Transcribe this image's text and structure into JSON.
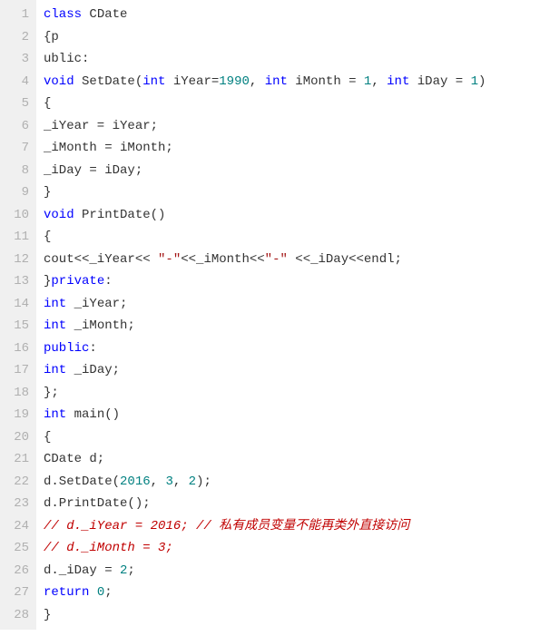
{
  "lines": [
    {
      "n": "1",
      "tokens": [
        {
          "t": "kw",
          "v": "class"
        },
        {
          "t": "plain",
          "v": " CDate"
        }
      ]
    },
    {
      "n": "2",
      "tokens": [
        {
          "t": "plain",
          "v": "{p"
        }
      ]
    },
    {
      "n": "3",
      "tokens": [
        {
          "t": "plain",
          "v": "ublic:"
        }
      ]
    },
    {
      "n": "4",
      "tokens": [
        {
          "t": "kw",
          "v": "void"
        },
        {
          "t": "plain",
          "v": " SetDate("
        },
        {
          "t": "kw",
          "v": "int"
        },
        {
          "t": "plain",
          "v": " iYear="
        },
        {
          "t": "num",
          "v": "1990"
        },
        {
          "t": "plain",
          "v": ", "
        },
        {
          "t": "kw",
          "v": "int"
        },
        {
          "t": "plain",
          "v": " iMonth = "
        },
        {
          "t": "num",
          "v": "1"
        },
        {
          "t": "plain",
          "v": ", "
        },
        {
          "t": "kw",
          "v": "int"
        },
        {
          "t": "plain",
          "v": " iDay = "
        },
        {
          "t": "num",
          "v": "1"
        },
        {
          "t": "plain",
          "v": ")"
        }
      ]
    },
    {
      "n": "5",
      "tokens": [
        {
          "t": "plain",
          "v": "{"
        }
      ]
    },
    {
      "n": "6",
      "tokens": [
        {
          "t": "plain",
          "v": "_iYear = iYear;"
        }
      ]
    },
    {
      "n": "7",
      "tokens": [
        {
          "t": "plain",
          "v": "_iMonth = iMonth;"
        }
      ]
    },
    {
      "n": "8",
      "tokens": [
        {
          "t": "plain",
          "v": "_iDay = iDay;"
        }
      ]
    },
    {
      "n": "9",
      "tokens": [
        {
          "t": "plain",
          "v": "}"
        }
      ]
    },
    {
      "n": "10",
      "tokens": [
        {
          "t": "kw",
          "v": "void"
        },
        {
          "t": "plain",
          "v": " PrintDate()"
        }
      ]
    },
    {
      "n": "11",
      "tokens": [
        {
          "t": "plain",
          "v": "{"
        }
      ]
    },
    {
      "n": "12",
      "tokens": [
        {
          "t": "plain",
          "v": "cout<<_iYear<< "
        },
        {
          "t": "str",
          "v": "\"-\""
        },
        {
          "t": "plain",
          "v": "<<_iMonth<<"
        },
        {
          "t": "str",
          "v": "\"-\""
        },
        {
          "t": "plain",
          "v": " <<_iDay<<endl;"
        }
      ]
    },
    {
      "n": "13",
      "tokens": [
        {
          "t": "plain",
          "v": "}"
        },
        {
          "t": "kw",
          "v": "private"
        },
        {
          "t": "plain",
          "v": ":"
        }
      ]
    },
    {
      "n": "14",
      "tokens": [
        {
          "t": "kw",
          "v": "int"
        },
        {
          "t": "plain",
          "v": " _iYear;"
        }
      ]
    },
    {
      "n": "15",
      "tokens": [
        {
          "t": "kw",
          "v": "int"
        },
        {
          "t": "plain",
          "v": " _iMonth;"
        }
      ]
    },
    {
      "n": "16",
      "tokens": [
        {
          "t": "kw",
          "v": "public"
        },
        {
          "t": "plain",
          "v": ":"
        }
      ]
    },
    {
      "n": "17",
      "tokens": [
        {
          "t": "kw",
          "v": "int"
        },
        {
          "t": "plain",
          "v": " _iDay;"
        }
      ]
    },
    {
      "n": "18",
      "tokens": [
        {
          "t": "plain",
          "v": "};"
        }
      ]
    },
    {
      "n": "19",
      "tokens": [
        {
          "t": "kw",
          "v": "int"
        },
        {
          "t": "plain",
          "v": " main()"
        }
      ]
    },
    {
      "n": "20",
      "tokens": [
        {
          "t": "plain",
          "v": "{"
        }
      ]
    },
    {
      "n": "21",
      "tokens": [
        {
          "t": "plain",
          "v": "CDate d;"
        }
      ]
    },
    {
      "n": "22",
      "tokens": [
        {
          "t": "plain",
          "v": "d.SetDate("
        },
        {
          "t": "num",
          "v": "2016"
        },
        {
          "t": "plain",
          "v": ", "
        },
        {
          "t": "num",
          "v": "3"
        },
        {
          "t": "plain",
          "v": ", "
        },
        {
          "t": "num",
          "v": "2"
        },
        {
          "t": "plain",
          "v": ");"
        }
      ]
    },
    {
      "n": "23",
      "tokens": [
        {
          "t": "plain",
          "v": "d.PrintDate();"
        }
      ]
    },
    {
      "n": "24",
      "tokens": [
        {
          "t": "comment",
          "v": "// d._iYear = 2016; // 私有成员变量不能再类外直接访问"
        }
      ]
    },
    {
      "n": "25",
      "tokens": [
        {
          "t": "comment",
          "v": "// d._iMonth = 3;"
        }
      ]
    },
    {
      "n": "26",
      "tokens": [
        {
          "t": "plain",
          "v": "d._iDay = "
        },
        {
          "t": "num",
          "v": "2"
        },
        {
          "t": "plain",
          "v": ";"
        }
      ]
    },
    {
      "n": "27",
      "tokens": [
        {
          "t": "kw",
          "v": "return"
        },
        {
          "t": "plain",
          "v": " "
        },
        {
          "t": "num",
          "v": "0"
        },
        {
          "t": "plain",
          "v": ";"
        }
      ]
    },
    {
      "n": "28",
      "tokens": [
        {
          "t": "plain",
          "v": "}"
        }
      ]
    }
  ]
}
